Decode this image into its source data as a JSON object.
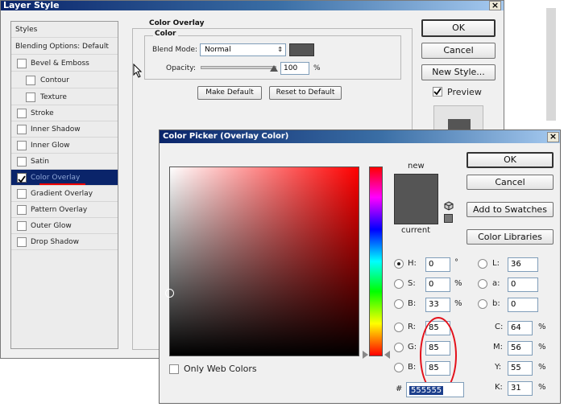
{
  "layer_style": {
    "title": "Layer Style",
    "close_glyph": "×",
    "styles_header": "Styles",
    "blending_options": "Blending Options: Default",
    "items": [
      {
        "label": "Bevel & Emboss",
        "checked": false
      },
      {
        "label": "Contour",
        "checked": false
      },
      {
        "label": "Texture",
        "checked": false
      },
      {
        "label": "Stroke",
        "checked": false
      },
      {
        "label": "Inner Shadow",
        "checked": false
      },
      {
        "label": "Inner Glow",
        "checked": false
      },
      {
        "label": "Satin",
        "checked": false
      },
      {
        "label": "Color Overlay",
        "checked": true
      },
      {
        "label": "Gradient Overlay",
        "checked": false
      },
      {
        "label": "Pattern Overlay",
        "checked": false
      },
      {
        "label": "Outer Glow",
        "checked": false
      },
      {
        "label": "Drop Shadow",
        "checked": false
      }
    ],
    "section_title": "Color Overlay",
    "subsection_title": "Color",
    "blend_mode_label": "Blend Mode:",
    "blend_mode_value": "Normal",
    "opacity_label": "Opacity:",
    "opacity_value": "100",
    "opacity_unit": "%",
    "make_default": "Make Default",
    "reset_default": "Reset to Default",
    "ok": "OK",
    "cancel": "Cancel",
    "new_style": "New Style...",
    "preview_label": "Preview",
    "preview_checked": true,
    "overlay_color": "#555555"
  },
  "color_picker": {
    "title": "Color Picker (Overlay Color)",
    "close_glyph": "×",
    "new_label": "new",
    "current_label": "current",
    "ok": "OK",
    "cancel": "Cancel",
    "add_swatches": "Add to Swatches",
    "color_libraries": "Color Libraries",
    "only_web_colors": "Only Web Colors",
    "hash": "#",
    "hex": "555555",
    "hsb": [
      {
        "label": "H:",
        "value": "0",
        "unit": "°",
        "selected": true
      },
      {
        "label": "S:",
        "value": "0",
        "unit": "%",
        "selected": false
      },
      {
        "label": "B:",
        "value": "33",
        "unit": "%",
        "selected": false
      }
    ],
    "rgb": [
      {
        "label": "R:",
        "value": "85",
        "selected": false
      },
      {
        "label": "G:",
        "value": "85",
        "selected": false
      },
      {
        "label": "B:",
        "value": "85",
        "selected": false
      }
    ],
    "lab": [
      {
        "label": "L:",
        "value": "36"
      },
      {
        "label": "a:",
        "value": "0"
      },
      {
        "label": "b:",
        "value": "0"
      }
    ],
    "cmyk": [
      {
        "label": "C:",
        "value": "64",
        "unit": "%"
      },
      {
        "label": "M:",
        "value": "56",
        "unit": "%"
      },
      {
        "label": "Y:",
        "value": "55",
        "unit": "%"
      },
      {
        "label": "K:",
        "value": "31",
        "unit": "%"
      }
    ]
  }
}
